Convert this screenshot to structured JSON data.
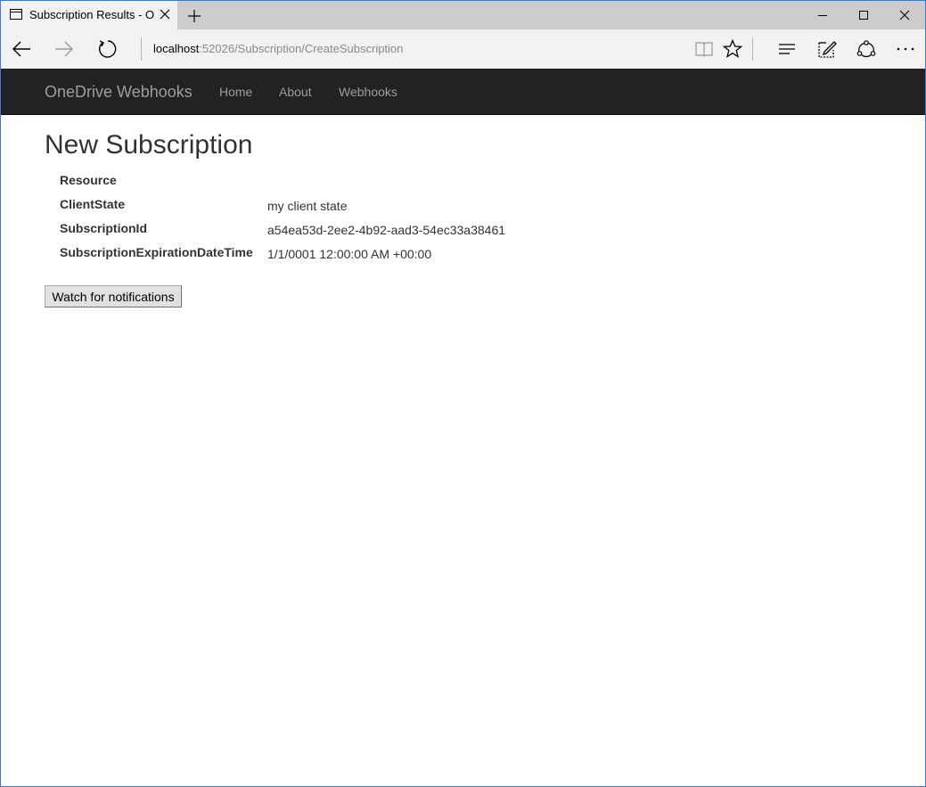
{
  "browser": {
    "tab_title": "Subscription Results - O",
    "address_host": "localhost",
    "address_rest": ":52026/Subscription/CreateSubscription"
  },
  "site": {
    "brand": "OneDrive Webhooks",
    "nav": [
      "Home",
      "About",
      "Webhooks"
    ]
  },
  "page": {
    "title": "New Subscription",
    "fields": [
      {
        "label": "Resource",
        "value": ""
      },
      {
        "label": "ClientState",
        "value": "my client state"
      },
      {
        "label": "SubscriptionId",
        "value": "a54ea53d-2ee2-4b92-aad3-54ec33a38461"
      },
      {
        "label": "SubscriptionExpirationDateTime",
        "value": "1/1/0001 12:00:00 AM +00:00"
      }
    ],
    "watch_button": "Watch for notifications"
  },
  "colors": {
    "navbar_bg": "#222222",
    "navbar_text": "#9d9d9d",
    "window_border": "#3a7bd5"
  }
}
